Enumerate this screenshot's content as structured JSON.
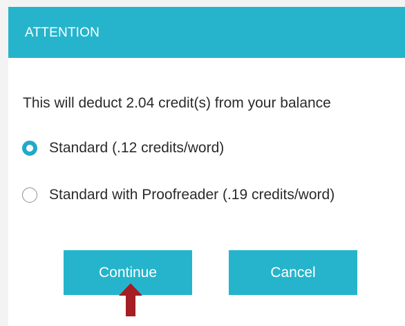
{
  "dialog": {
    "title": "ATTENTION",
    "message": "This will deduct 2.04 credit(s) from your balance",
    "options": [
      {
        "label": "Standard (.12 credits/word)",
        "selected": true
      },
      {
        "label": "Standard with Proofreader (.19 credits/word)",
        "selected": false
      }
    ],
    "buttons": {
      "continue_label": "Continue",
      "cancel_label": "Cancel"
    }
  },
  "colors": {
    "accent": "#25b4cc",
    "radio_selected": "#22a9c9",
    "pointer_arrow": "#a41e23"
  },
  "icons": {
    "pointer": "up-arrow-icon"
  }
}
